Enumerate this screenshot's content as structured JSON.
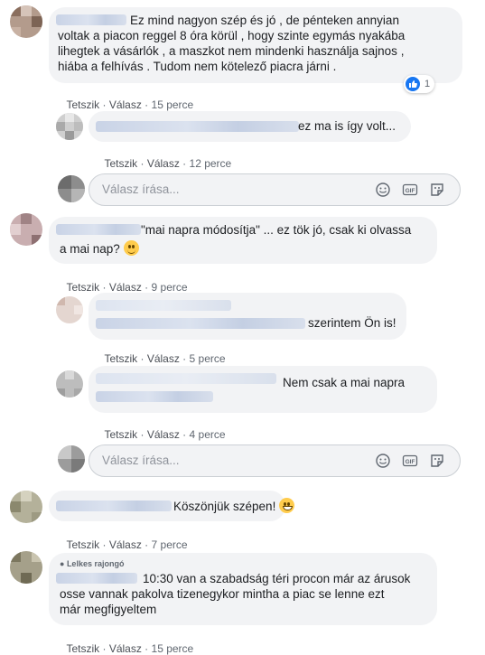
{
  "comments": [
    {
      "text": "Ez mind nagyon szép és jó , de pénteken annyian\nvoltak a piacon reggel 8 óra körül , hogy szinte egymás nyakába\nlihegtek a vásárlók , a maszkot nem mindenki használja sajnos ,\nhiába a felhívás . Tudom nem kötelező piacra járni .",
      "reaction_count": "1",
      "like": "Tetszik",
      "reply": "Válasz",
      "time": "15 perce"
    },
    {
      "text": "ez ma is így volt...",
      "like": "Tetszik",
      "reply": "Válasz",
      "time": "12 perce"
    },
    {
      "text1": "\"mai napra módosítja\" ... ez tök jó, csak ki olvassa",
      "text2": "a mai nap?",
      "like": "Tetszik",
      "reply": "Válasz",
      "time": "9 perce"
    },
    {
      "text": "szerintem Ön is!",
      "like": "Tetszik",
      "reply": "Válasz",
      "time": "5 perce"
    },
    {
      "text": "Nem csak a mai napra",
      "like": "Tetszik",
      "reply": "Válasz",
      "time": "4 perce"
    },
    {
      "text": "Köszönjük szépen!",
      "like": "Tetszik",
      "reply": "Válasz",
      "time": "7 perce"
    },
    {
      "badge": "Lelkes rajongó",
      "text": "10:30 van a szabadság téri procon már az árusok\nosse vannak pakolva tizenegykor mintha a piac se lenne ezt\nmár megfigyeltem",
      "like": "Tetszik",
      "reply": "Válasz",
      "time": "15 perce"
    }
  ],
  "reply_inputs": [
    {
      "placeholder": "Válasz írása..."
    },
    {
      "placeholder": "Válasz írása..."
    }
  ],
  "icons": [
    "emoji-icon",
    "gif-icon",
    "sticker-icon",
    "like-reaction-icon"
  ],
  "colors": {
    "bubble": "#f2f3f5",
    "link": "#4b4f56",
    "meta": "#606770",
    "like_blue": "#1877f2"
  }
}
